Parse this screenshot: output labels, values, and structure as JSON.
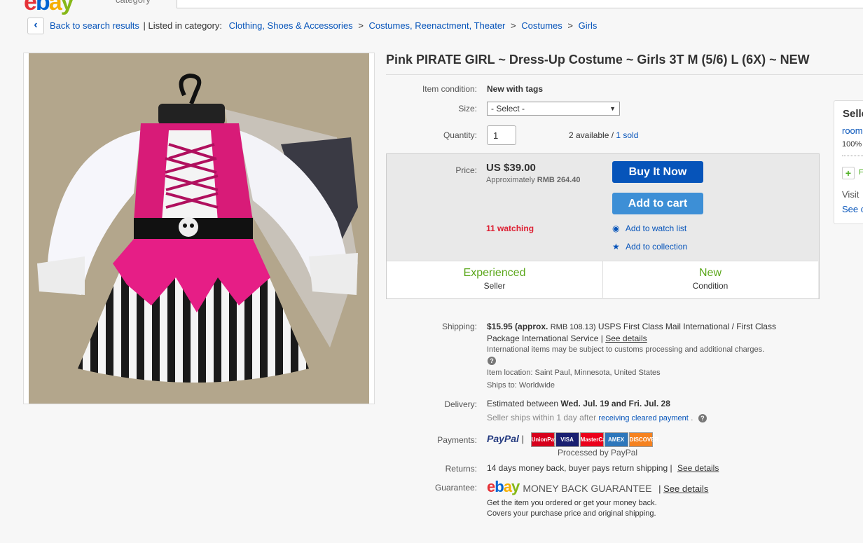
{
  "header": {
    "logo_letters": [
      "e",
      "b",
      "a",
      "y"
    ],
    "category_label": "category"
  },
  "breadcrumb": {
    "back_label": "Back to search results",
    "listed_in": "| Listed in category:",
    "items": [
      "Clothing, Shoes & Accessories",
      "Costumes, Reenactment, Theater",
      "Costumes",
      "Girls"
    ],
    "separator": ">"
  },
  "item": {
    "title": "Pink PIRATE GIRL ~ Dress-Up Costume ~ Girls 3T M (5/6) L (6X) ~ NEW",
    "condition_label": "Item condition:",
    "condition_value": "New with tags",
    "size_label": "Size:",
    "size_value": "- Select -",
    "quantity_label": "Quantity:",
    "quantity_value": "1",
    "available": "2 available",
    "available_sep": "/",
    "sold": "1 sold"
  },
  "buy": {
    "price_label": "Price:",
    "price": "US $39.00",
    "approx_prefix": "Approximately",
    "approx_value": "RMB 264.40",
    "watching": "11 watching",
    "buy_now": "Buy It Now",
    "add_to_cart": "Add to cart",
    "watch_list": "Add to watch list",
    "collection": "Add to collection",
    "stats": [
      {
        "top": "Experienced",
        "bottom": "Seller"
      },
      {
        "top": "New",
        "bottom": "Condition"
      }
    ]
  },
  "shipping": {
    "label": "Shipping:",
    "cost": "$15.95",
    "approx": "(approx.",
    "approx_value": "RMB 108.13)",
    "method": "USPS First Class Mail International / First Class",
    "method2": "Package International Service |",
    "see_details": "See details",
    "intl_note": "International items may be subject to customs processing and additional charges.",
    "location_label": "Item location:",
    "location": "Saint Paul, Minnesota, United States",
    "ships_label": "Ships to:",
    "ships_to": "Worldwide"
  },
  "delivery": {
    "label": "Delivery:",
    "estimated": "Estimated between",
    "dates": "Wed. Jul. 19 and Fri. Jul. 28",
    "seller_ships": "Seller ships within 1 day after",
    "cleared_link": "receiving cleared payment",
    "period": "."
  },
  "payments": {
    "label": "Payments:",
    "paypal": "PayPal",
    "pipe": "|",
    "cards": [
      {
        "name": "UnionPay",
        "color": "#d6001c"
      },
      {
        "name": "VISA",
        "color": "#1a1f71"
      },
      {
        "name": "MasterCard",
        "color": "#eb001b"
      },
      {
        "name": "AMEX",
        "color": "#2e77bb"
      },
      {
        "name": "DISCOVER",
        "color": "#f58220"
      }
    ],
    "processed": "Processed by PayPal"
  },
  "returns": {
    "label": "Returns:",
    "text": "14 days money back, buyer pays return shipping |",
    "see_details": "See details"
  },
  "guarantee": {
    "label": "Guarantee:",
    "mbg": "MONEY BACK GUARANTEE",
    "pipe": "|",
    "see_details": "See details",
    "line1": "Get the item you ordered or get your money back.",
    "line2": "Covers your purchase price and original shipping."
  },
  "seller_panel": {
    "title": "Selle",
    "name": "room",
    "feedback": "100%",
    "save": "F",
    "visit": "Visit",
    "see": "See c"
  },
  "colors": {
    "link": "#0654ba",
    "buy_button": "#0654ba",
    "cart_button": "#3d8fd6",
    "watching": "#dd1e31",
    "stat_green": "#5ba71b"
  }
}
